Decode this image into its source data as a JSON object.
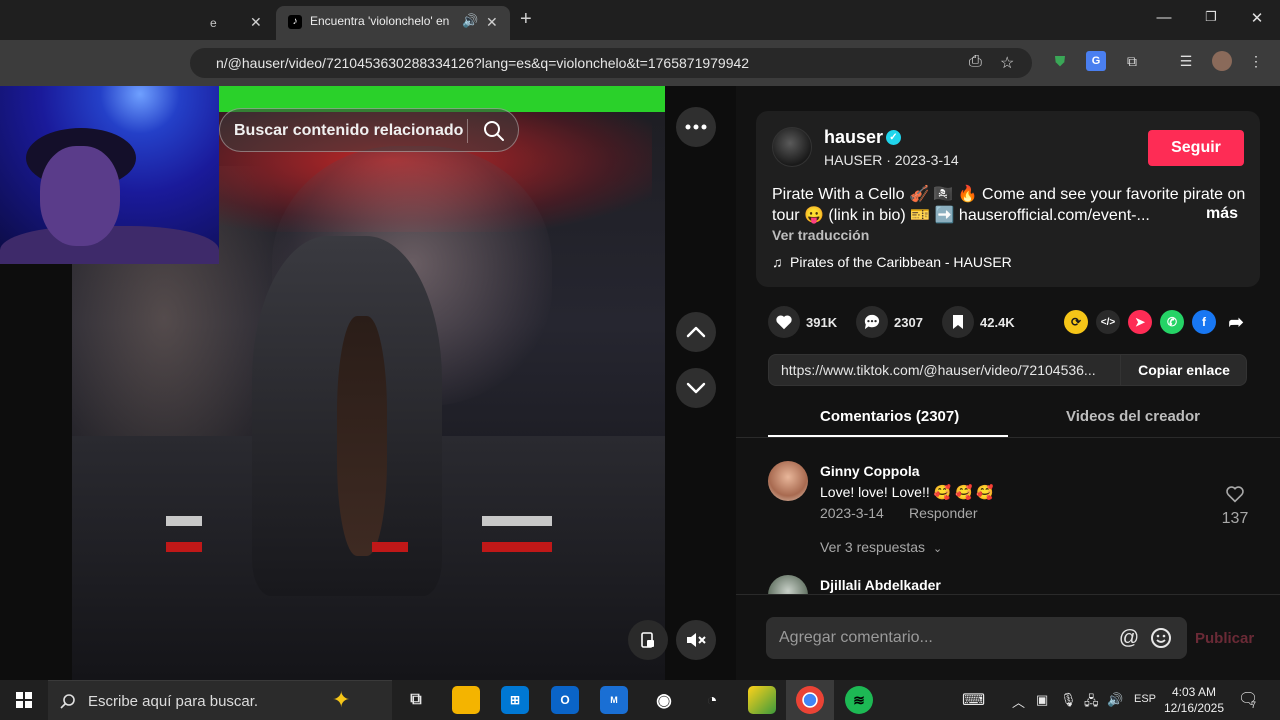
{
  "browser": {
    "prev_tab_title": "e",
    "active_tab_title": "Encuentra 'violonchelo' en T",
    "address": "n/@hauser/video/7210453630288334126?lang=es&q=violonchelo&t=1765871979942"
  },
  "video": {
    "search_placeholder": "Buscar contenido relacionado"
  },
  "post": {
    "author_name": "hauser",
    "author_meta": "HAUSER · 2023-3-14",
    "follow_label": "Seguir",
    "description": "Pirate With a Cello 🎻 🏴‍☠️ 🔥 Come and see your favorite pirate on tour 😛 (link in bio) 🎫 ➡️ hauserofficial.com/event-...",
    "more_label": "más",
    "translate_label": "Ver traducción",
    "music": "Pirates of the Caribbean - HAUSER"
  },
  "stats": {
    "likes": "391K",
    "comments": "2307",
    "saves": "42.4K"
  },
  "share": {
    "link": "https://www.tiktok.com/@hauser/video/72104536...",
    "copy_label": "Copiar enlace"
  },
  "tabs": {
    "comments": "Comentarios (2307)",
    "creator": "Videos del creador"
  },
  "comments": [
    {
      "name": "Ginny Coppola",
      "text": "Love! love! Love!! 🥰 🥰 🥰",
      "date": "2023-3-14",
      "reply": "Responder",
      "likes": "137",
      "replies": "Ver 3 respuestas"
    },
    {
      "name": "Djillali Abdelkader"
    }
  ],
  "comment_input": {
    "placeholder": "Agregar comentario...",
    "post_label": "Publicar"
  },
  "taskbar": {
    "search_placeholder": "Escribe aquí para buscar.",
    "lang": "ESP",
    "time": "4:03 AM",
    "date": "12/16/2025",
    "notifications": "7"
  },
  "colors": {
    "follow": "#fe2c55",
    "verified": "#20d5ec",
    "background": "#121212"
  }
}
